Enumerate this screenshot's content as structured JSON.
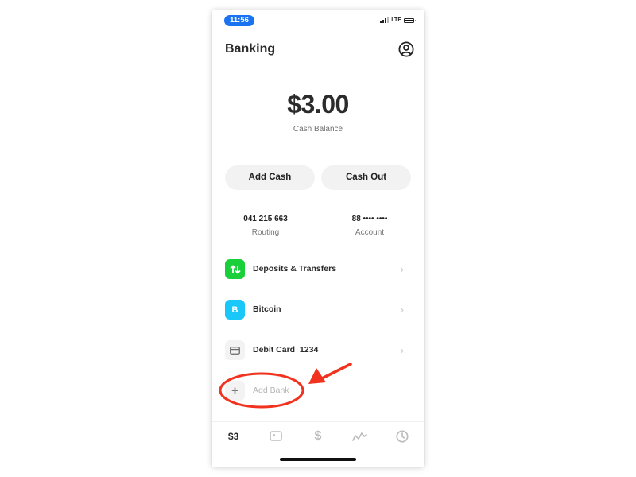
{
  "status_bar": {
    "time": "11:56",
    "network": "LTE",
    "icons": [
      "signal-icon",
      "battery-icon"
    ]
  },
  "header": {
    "title": "Banking",
    "profile_icon": "profile-icon"
  },
  "balance": {
    "amount": "$3.00",
    "label": "Cash Balance"
  },
  "actions": {
    "add_cash": "Add Cash",
    "cash_out": "Cash Out"
  },
  "account_info": {
    "routing_number": "041 215 663",
    "routing_label": "Routing",
    "account_number": "88 •••• ••••",
    "account_label": "Account"
  },
  "list": {
    "items": [
      {
        "label": "Deposits & Transfers",
        "icon": "arrows-up-down-icon",
        "color": "#1ad03a"
      },
      {
        "label": "Bitcoin",
        "icon": "bitcoin-icon",
        "glyph": "B",
        "color": "#19c8f8"
      },
      {
        "label": "Debit Card  1234",
        "icon": "card-icon",
        "color": "#f3f3f3"
      },
      {
        "label": "Add Bank",
        "icon": "plus-icon",
        "glyph": "+"
      }
    ]
  },
  "annotation": {
    "type": "red circle and arrow highlighting Add Bank",
    "color": "#f0321e"
  },
  "tab_bar": {
    "tabs": [
      {
        "label": "$3",
        "icon": "cash-tab"
      },
      {
        "icon": "card-tab-icon"
      },
      {
        "icon": "dollar-tab-icon",
        "glyph": "$"
      },
      {
        "icon": "investing-tab-icon"
      },
      {
        "icon": "activity-clock-icon"
      }
    ]
  }
}
